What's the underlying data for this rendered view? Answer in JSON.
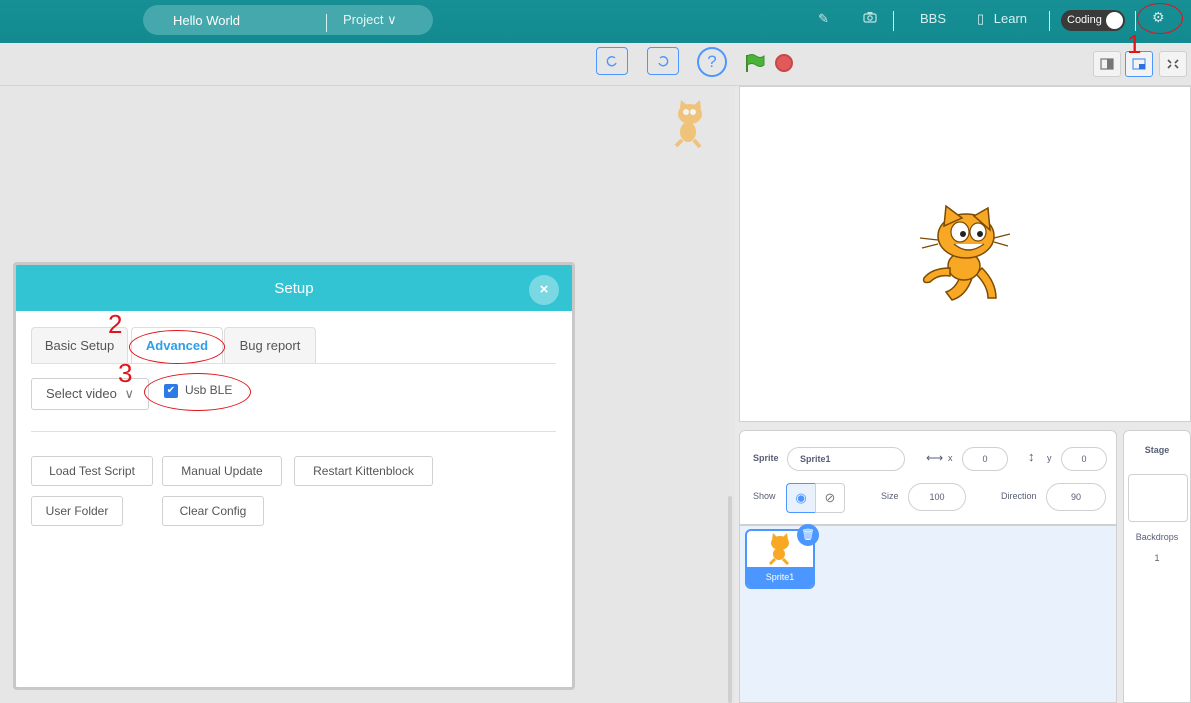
{
  "topbar": {
    "project_name": "Hello World",
    "project_menu": "Project ∨",
    "bbs": "BBS",
    "learn": "Learn",
    "coding": "Coding"
  },
  "sprite_info": {
    "sprite_label": "Sprite",
    "sprite_name": "Sprite1",
    "x_label": "x",
    "x_value": "0",
    "y_label": "y",
    "y_value": "0",
    "show_label": "Show",
    "size_label": "Size",
    "size_value": "100",
    "direction_label": "Direction",
    "direction_value": "90"
  },
  "sprite_list": {
    "tile_label": "Sprite1"
  },
  "stage_col": {
    "title": "Stage",
    "backdrops_label": "Backdrops",
    "backdrops_count": "1"
  },
  "modal": {
    "title": "Setup",
    "close": "×",
    "tabs": [
      {
        "label": "Basic Setup"
      },
      {
        "label": "Advanced"
      },
      {
        "label": "Bug report"
      }
    ],
    "select_video": "Select video",
    "usb_ble": "Usb BLE",
    "buttons": [
      {
        "label": "Load Test Script"
      },
      {
        "label": "Manual Update"
      },
      {
        "label": "Restart Kittenblock"
      },
      {
        "label": "User Folder"
      },
      {
        "label": "Clear Config"
      }
    ]
  },
  "annotations": [
    "1",
    "2",
    "3"
  ],
  "colors": {
    "topbar": "#128a90",
    "modal_header": "#33c4d4",
    "accent_blue": "#4c97ff",
    "annotation_red": "#e1141c"
  }
}
